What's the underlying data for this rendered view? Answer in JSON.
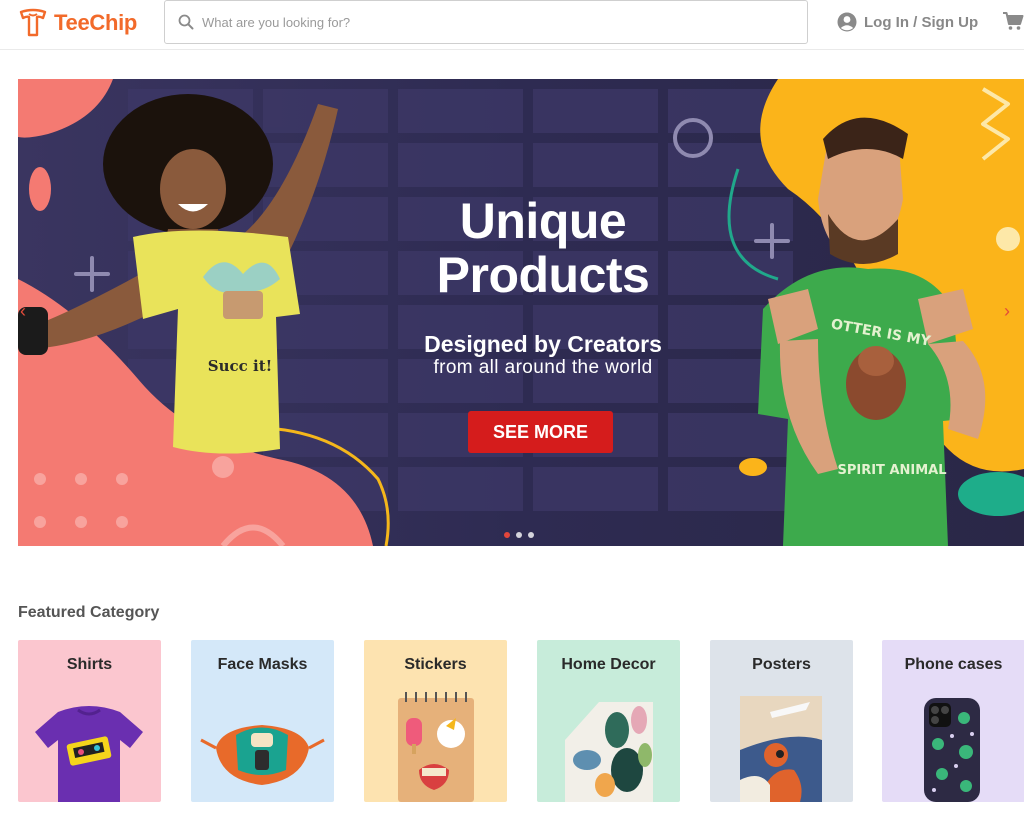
{
  "header": {
    "logo_text": "TeeChip",
    "search_placeholder": "What are you looking for?",
    "login_label": "Log In / Sign Up"
  },
  "hero": {
    "title_line1": "Unique",
    "title_line2": "Products",
    "subtitle_line1": "Designed by Creators",
    "subtitle_line2": "from all around the world",
    "cta_label": "SEE MORE",
    "shirt_left_text": "Succ it!",
    "shirt_right_text_top": "OTTER IS MY",
    "shirt_right_text_bottom": "SPIRIT ANIMAL",
    "slides_total": 3,
    "slide_active": 1
  },
  "featured": {
    "title": "Featured Category",
    "categories": [
      {
        "label": "Shirts",
        "color": "#fbc6cf"
      },
      {
        "label": "Face Masks",
        "color": "#d4e8f9"
      },
      {
        "label": "Stickers",
        "color": "#fde3b0"
      },
      {
        "label": "Home Decor",
        "color": "#c7ecda"
      },
      {
        "label": "Posters",
        "color": "#dde3ea"
      },
      {
        "label": "Phone cases",
        "color": "#e5dcf7"
      }
    ]
  },
  "colors": {
    "brand": "#f26a2a",
    "cta": "#d51c1c",
    "hero_bg": "#2d2a4e"
  }
}
